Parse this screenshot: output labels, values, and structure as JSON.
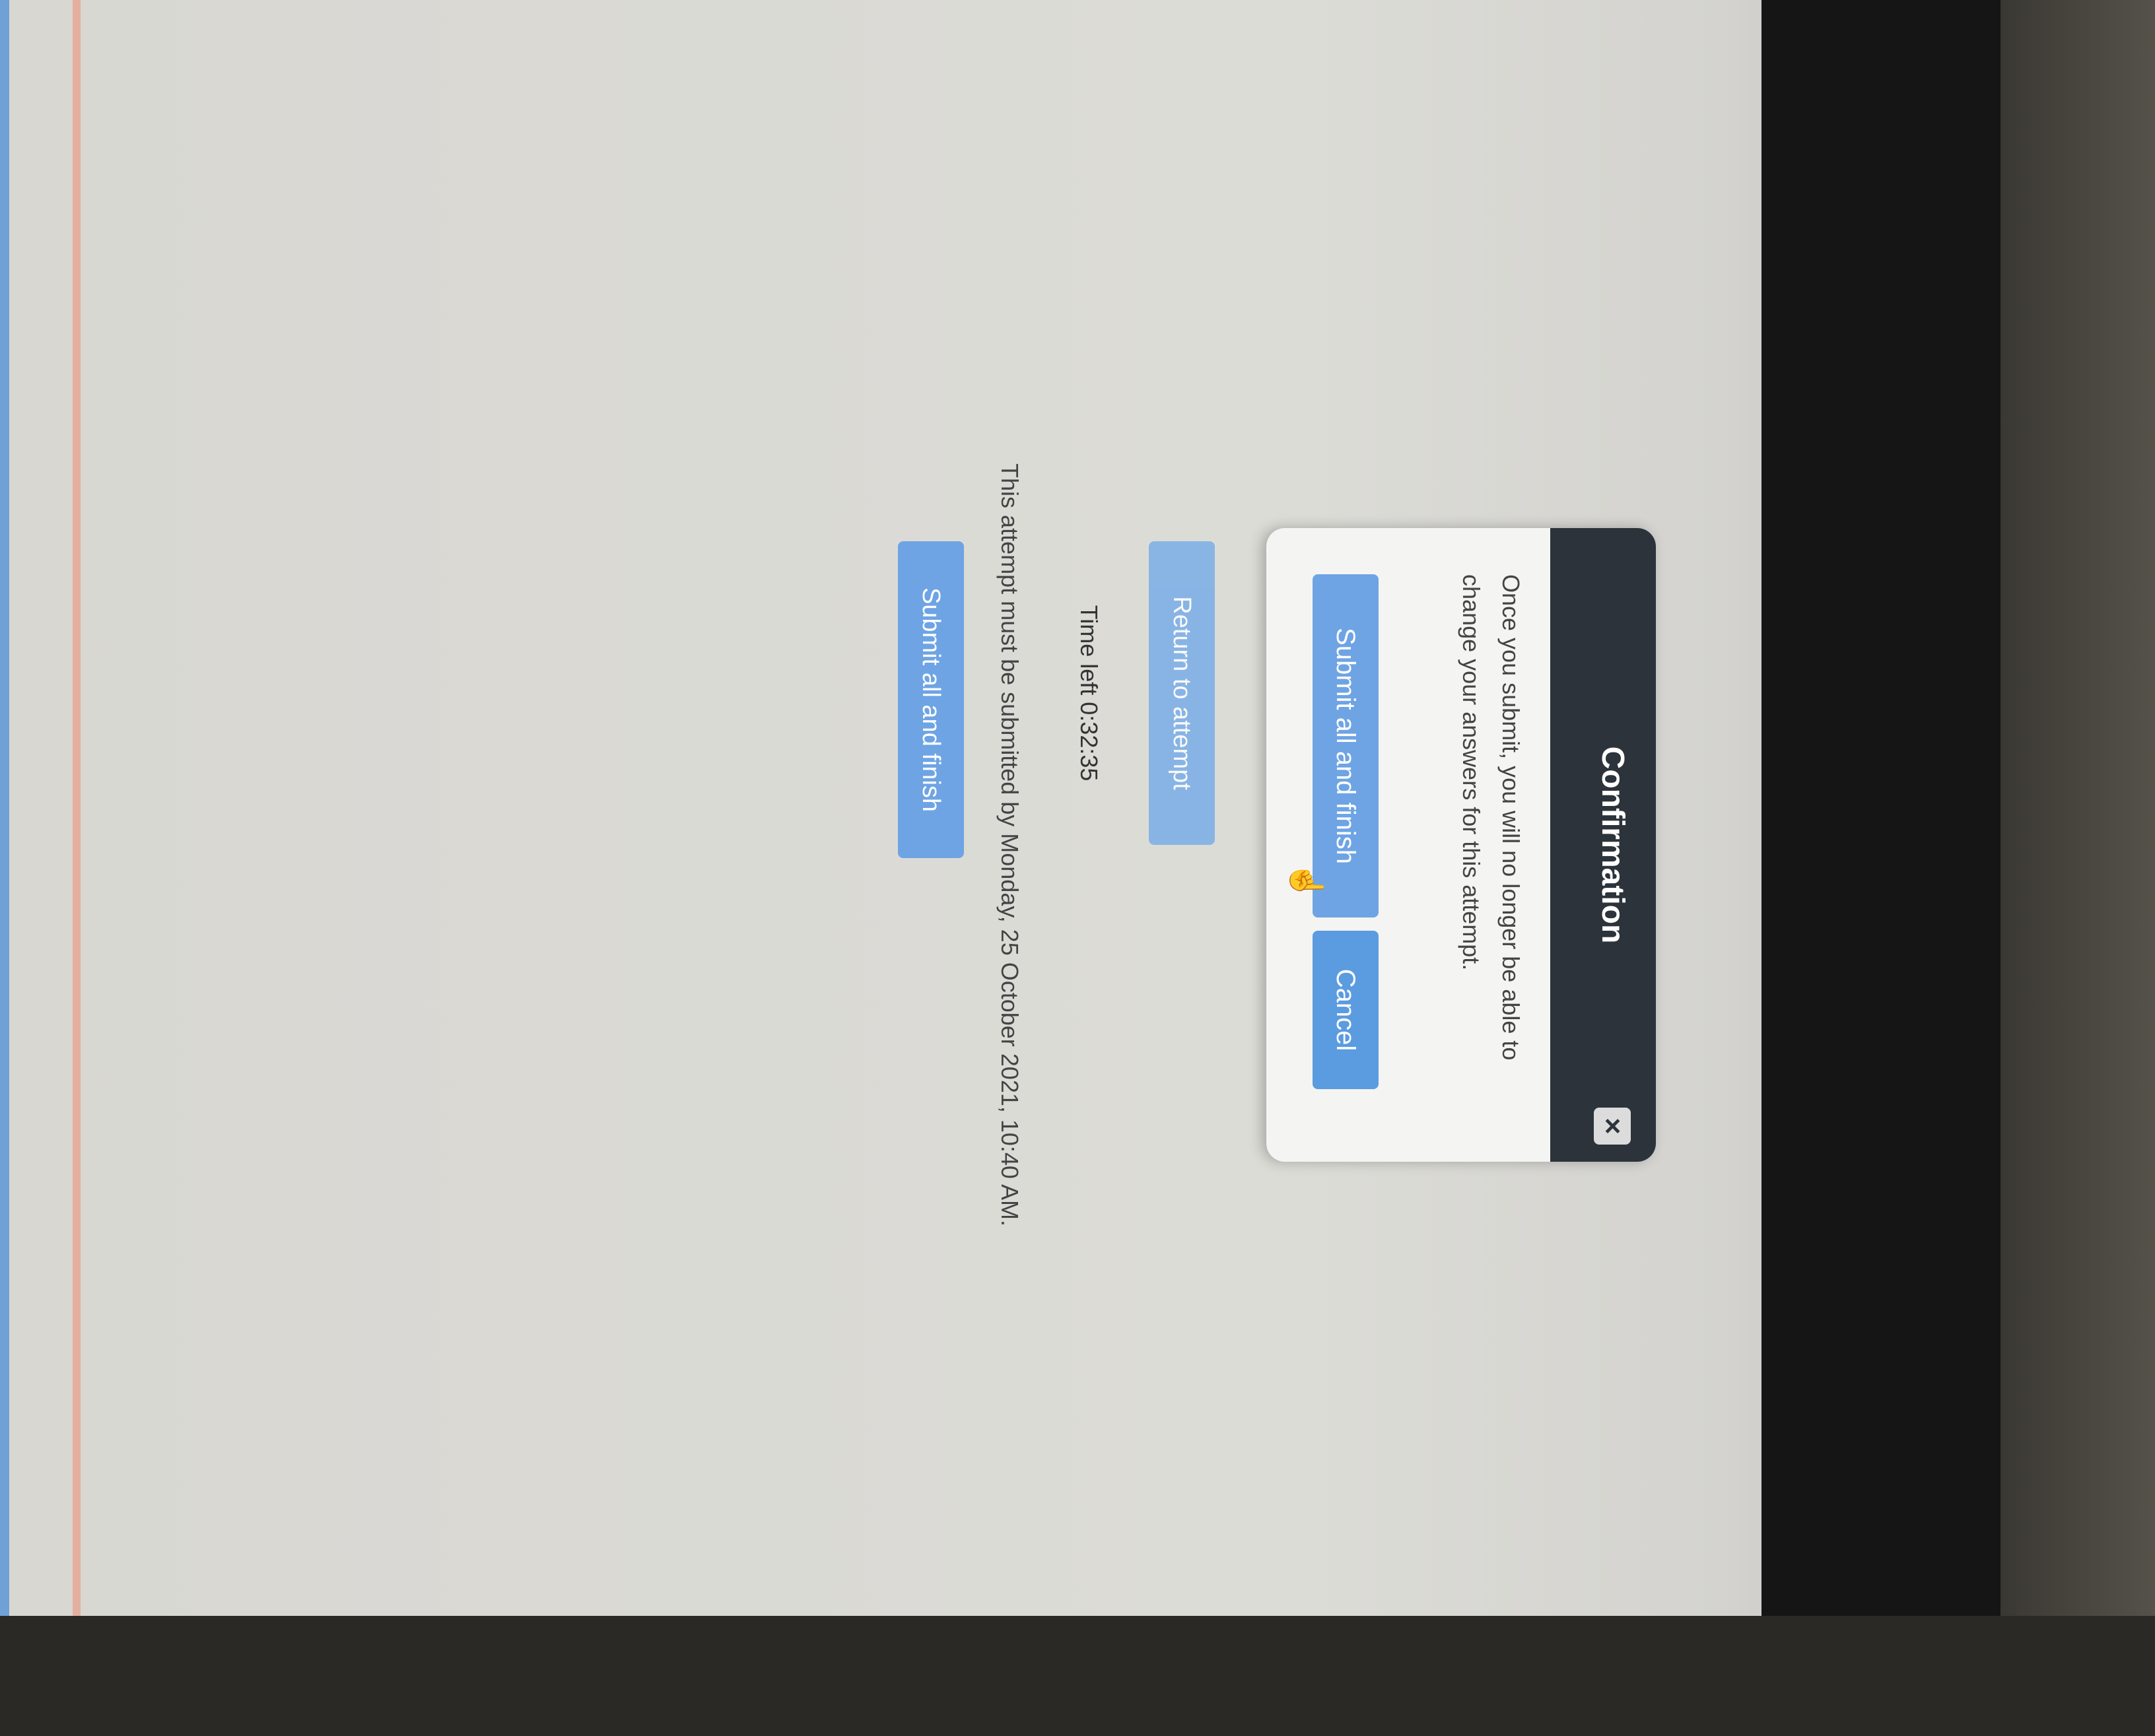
{
  "dialog": {
    "title": "Confirmation",
    "close_label": "×",
    "message": "Once you submit, you will no longer be able to change your answers for this attempt.",
    "submit_label": "Submit all and finish",
    "cancel_label": "Cancel"
  },
  "page": {
    "return_label": "Return to attempt",
    "time_left": "Time left 0:32:35",
    "deadline": "This attempt must be submitted by Monday, 25 October 2021, 10:40 AM.",
    "submit_label": "Submit all and finish"
  },
  "colors": {
    "header": "#2c333a",
    "button": "#5b9be0"
  }
}
